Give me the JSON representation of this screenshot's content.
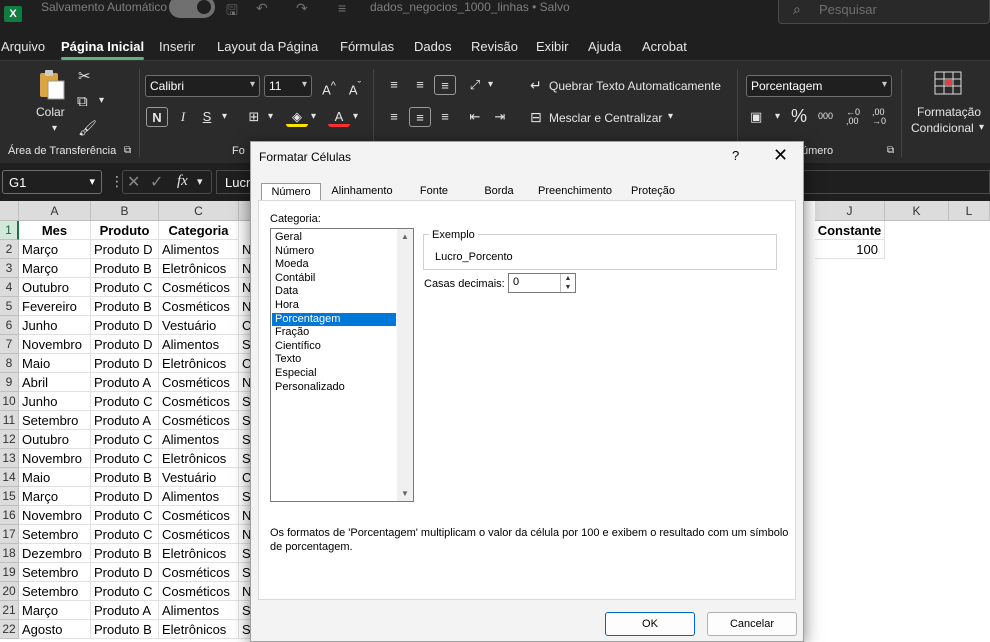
{
  "titlebar": {
    "autosave_label": "Salvamento Automático",
    "doc_title": "dados_negocios_1000_linhas • Salvo",
    "search_placeholder": "Pesquisar"
  },
  "menu": [
    "Arquivo",
    "Página Inicial",
    "Inserir",
    "Layout da Página",
    "Fórmulas",
    "Dados",
    "Revisão",
    "Exibir",
    "Ajuda",
    "Acrobat"
  ],
  "ribbon": {
    "paste_label": "Colar",
    "clipboard_group": "Área de Transferência",
    "font_name": "Calibri",
    "font_size": "11",
    "font_group_partial": "Fo",
    "wrap_text": "Quebrar Texto Automaticamente",
    "merge_center": "Mesclar e Centralizar",
    "number_format": "Porcentagem",
    "number_group_partial": "úmero",
    "cond_format_line1": "Formatação",
    "cond_format_line2": "Condicional"
  },
  "formula_bar": {
    "name_box": "G1",
    "formula_partial": "Lucro"
  },
  "columns": [
    "A",
    "B",
    "C",
    "J",
    "K",
    "L"
  ],
  "header_row": [
    "Mes",
    "Produto",
    "Categoria"
  ],
  "extra_header": "Constante",
  "constant_value": "100",
  "rows": [
    [
      "Março",
      "Produto D",
      "Alimentos",
      "N"
    ],
    [
      "Março",
      "Produto B",
      "Eletrônicos",
      "N"
    ],
    [
      "Outubro",
      "Produto C",
      "Cosméticos",
      "N"
    ],
    [
      "Fevereiro",
      "Produto B",
      "Cosméticos",
      "N"
    ],
    [
      "Junho",
      "Produto D",
      "Vestuário",
      "C"
    ],
    [
      "Novembro",
      "Produto D",
      "Alimentos",
      "S"
    ],
    [
      "Maio",
      "Produto D",
      "Eletrônicos",
      "C"
    ],
    [
      "Abril",
      "Produto A",
      "Cosméticos",
      "N"
    ],
    [
      "Junho",
      "Produto C",
      "Cosméticos",
      "S"
    ],
    [
      "Setembro",
      "Produto A",
      "Cosméticos",
      "S"
    ],
    [
      "Outubro",
      "Produto C",
      "Alimentos",
      "S"
    ],
    [
      "Novembro",
      "Produto C",
      "Eletrônicos",
      "S"
    ],
    [
      "Maio",
      "Produto B",
      "Vestuário",
      "C"
    ],
    [
      "Março",
      "Produto D",
      "Alimentos",
      "S"
    ],
    [
      "Novembro",
      "Produto C",
      "Cosméticos",
      "N"
    ],
    [
      "Setembro",
      "Produto C",
      "Cosméticos",
      "N"
    ],
    [
      "Dezembro",
      "Produto B",
      "Eletrônicos",
      "S"
    ],
    [
      "Setembro",
      "Produto D",
      "Cosméticos",
      "S"
    ],
    [
      "Setembro",
      "Produto C",
      "Cosméticos",
      "N"
    ],
    [
      "Março",
      "Produto A",
      "Alimentos",
      "S"
    ],
    [
      "Agosto",
      "Produto B",
      "Eletrônicos",
      "S"
    ]
  ],
  "dialog": {
    "title": "Formatar Células",
    "help": "?",
    "tabs": [
      "Número",
      "Alinhamento",
      "Fonte",
      "Borda",
      "Preenchimento",
      "Proteção"
    ],
    "category_label": "Categoria:",
    "categories": [
      "Geral",
      "Número",
      "Moeda",
      "Contábil",
      "Data",
      "Hora",
      "Porcentagem",
      "Fração",
      "Científico",
      "Texto",
      "Especial",
      "Personalizado"
    ],
    "selected_category": "Porcentagem",
    "example_label": "Exemplo",
    "example_value": "Lucro_Porcento",
    "decimals_label": "Casas decimais:",
    "decimals_value": "0",
    "description": "Os formatos de 'Porcentagem' multiplicam o valor da célula por 100 e exibem o resultado com um símbolo de porcentagem.",
    "ok": "OK",
    "cancel": "Cancelar"
  }
}
